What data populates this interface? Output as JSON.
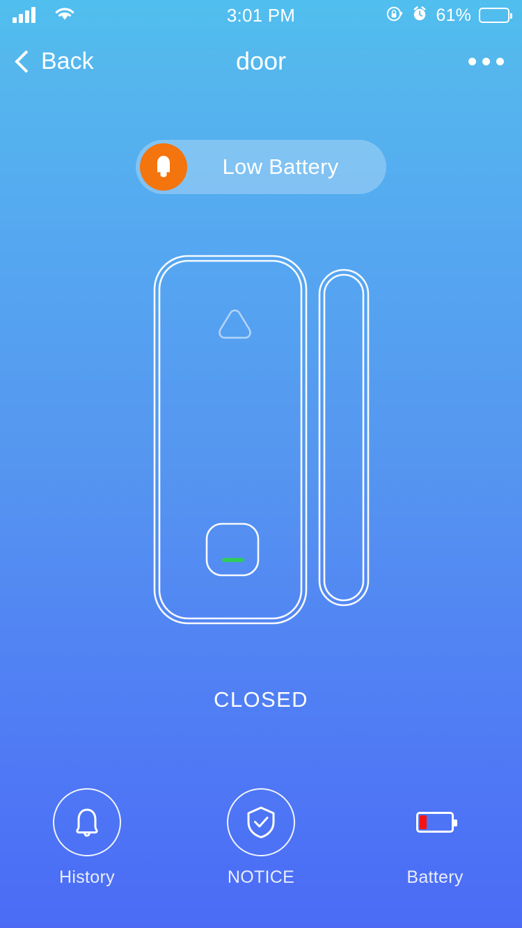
{
  "status_bar": {
    "signal_icon": "cellular-signal-icon",
    "wifi_icon": "wifi-icon",
    "time": "3:01 PM",
    "rotation_lock_icon": "rotation-lock-icon",
    "alarm_icon": "alarm-clock-icon",
    "battery_percent": "61%",
    "battery_level": 61,
    "battery_icon": "battery-icon"
  },
  "nav_bar": {
    "back_label": "Back",
    "back_icon": "chevron-left-icon",
    "title": "door",
    "more_icon": "more-options-icon"
  },
  "alert": {
    "label": "Low Battery",
    "icon": "bell-alert-icon",
    "icon_color": "#f4740d"
  },
  "device": {
    "logo_icon": "rounded-triangle-logo-icon",
    "button_icon": "sensor-button",
    "led_icon": "status-led-indicator",
    "led_color": "#2ecc5d",
    "magnet_icon": "magnet-piece"
  },
  "state": {
    "label": "CLOSED"
  },
  "actions": [
    {
      "label": "History",
      "icon": "bell-icon",
      "style": "circle"
    },
    {
      "label": "NOTICE",
      "icon": "shield-check-icon",
      "style": "circle"
    },
    {
      "label": "Battery",
      "icon": "battery-low-icon",
      "style": "plain"
    }
  ],
  "theme": {
    "gradient_top": "#50bfee",
    "gradient_bottom": "#4b6bf5",
    "accent_orange": "#f4740d",
    "led_green": "#2ecc5d",
    "battery_red": "#f41414"
  }
}
